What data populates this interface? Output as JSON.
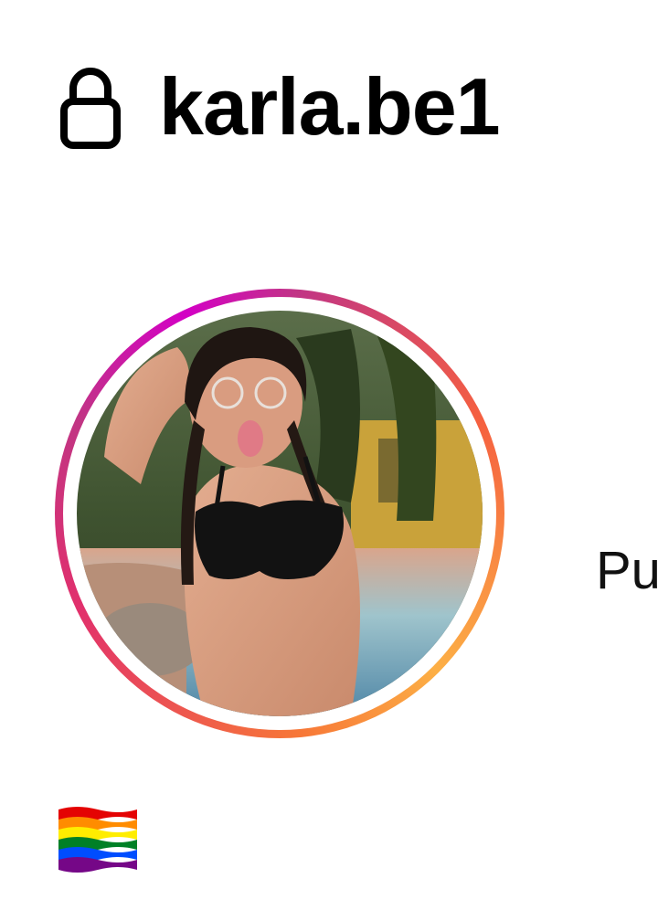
{
  "profile": {
    "username": "karla.be1",
    "is_private": true,
    "lock_icon": "lock-icon",
    "has_story": true,
    "avatar_icon": "profile-photo",
    "stats": {
      "posts_label_partial": "Pu"
    },
    "bio": {
      "emoji": "🏳️‍🌈",
      "emoji_icon": "rainbow-flag-icon"
    }
  },
  "colors": {
    "background": "#ffffff",
    "text": "#000000",
    "story_ring_start": "#fcaf45",
    "story_ring_mid": "#e1306c",
    "story_ring_end": "#d300c5"
  }
}
